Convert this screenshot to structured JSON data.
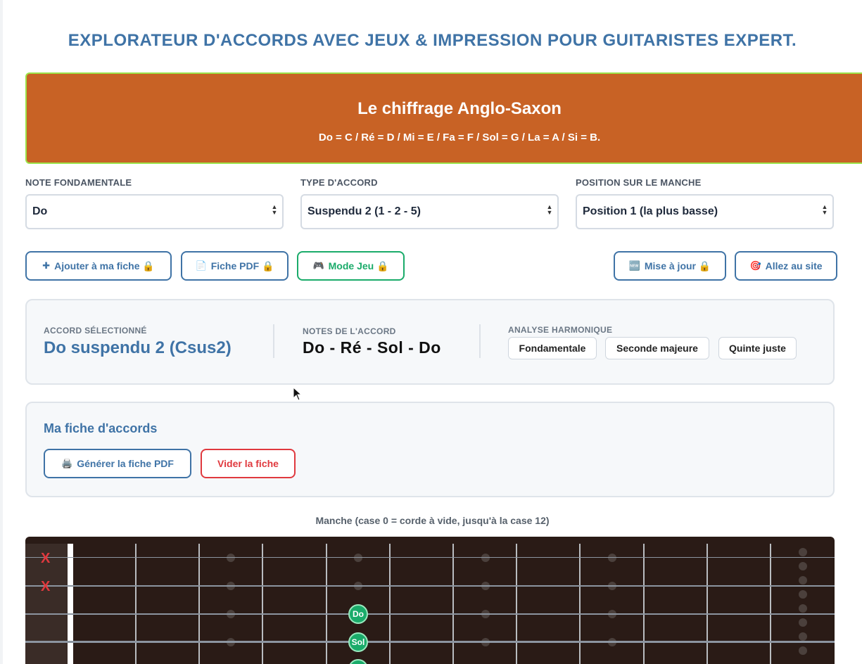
{
  "header": {
    "title": "EXPLORATEUR D'ACCORDS AVEC JEUX & IMPRESSION POUR GUITARISTES EXPERT."
  },
  "banner": {
    "title": "Le chiffrage Anglo-Saxon",
    "text": "Do = C / Ré = D / Mi = E / Fa = F / Sol = G / La = A / Si = B."
  },
  "controls": {
    "root": {
      "label": "NOTE FONDAMENTALE",
      "value": "Do"
    },
    "type": {
      "label": "TYPE D'ACCORD",
      "value": "Suspendu 2 (1 - 2 - 5)"
    },
    "position": {
      "label": "POSITION SUR LE MANCHE",
      "value": "Position 1 (la plus basse)"
    }
  },
  "toolbar": {
    "add": "Ajouter à ma fiche 🔒",
    "pdf": "Fiche PDF 🔒",
    "game": "Mode Jeu 🔒",
    "update": "Mise à jour 🔒",
    "site": "Allez au site"
  },
  "chord": {
    "selected_caption": "ACCORD SÉLECTIONNÉ",
    "name": "Do suspendu 2 (Csus2)",
    "notes_caption": "NOTES DE L'ACCORD",
    "notes": "Do - Ré - Sol - Do",
    "analysis_caption": "ANALYSE HARMONIQUE",
    "intervals": [
      "Fondamentale",
      "Seconde majeure",
      "Quinte juste"
    ]
  },
  "fiche": {
    "title": "Ma fiche d'accords",
    "generate": "Générer la fiche PDF",
    "clear": "Vider la fiche"
  },
  "neck": {
    "caption": "Manche (case 0 = corde à vide, jusqu'à la case 12)",
    "muted_symbol": "X",
    "visible_notes": [
      "Do",
      "Sol"
    ]
  },
  "colors": {
    "accent_blue": "#3f73a6",
    "banner": "#c86225",
    "banner_border": "#9be34a",
    "green": "#1aab6a",
    "red": "#e0393e",
    "neck": "#2a1b16"
  }
}
